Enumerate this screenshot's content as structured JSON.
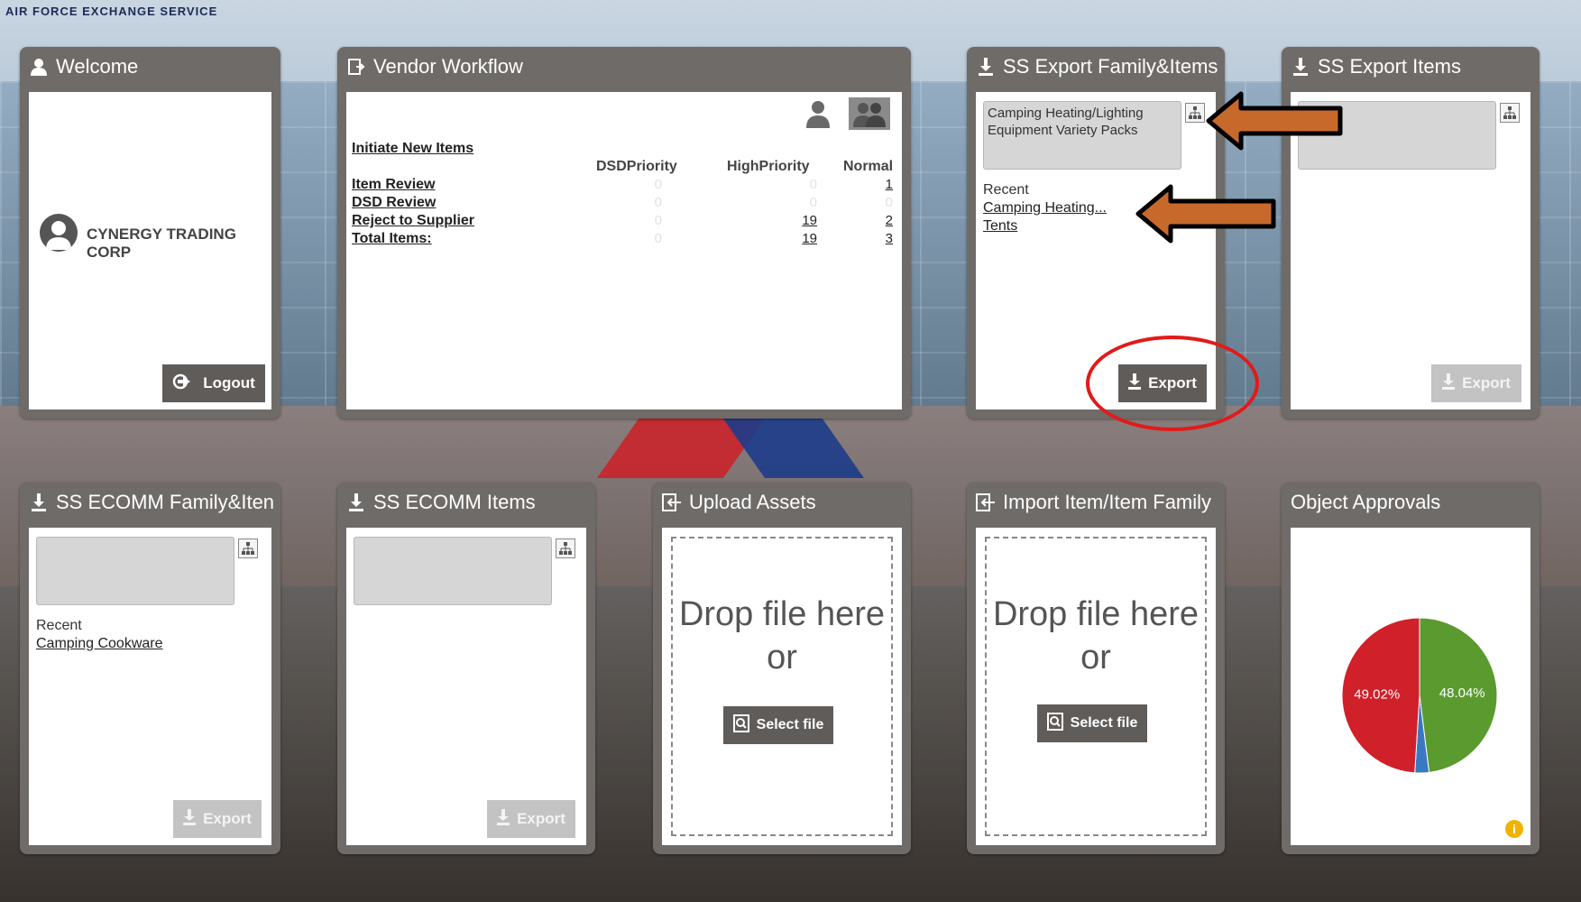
{
  "brand": "AIR FORCE EXCHANGE SERVICE",
  "welcome": {
    "title": "Welcome",
    "company": "CYNERGY TRADING CORP",
    "logout_label": "Logout"
  },
  "vendor_workflow": {
    "title": "Vendor Workflow",
    "initiate_label": "Initiate New Items",
    "columns": [
      "DSDPriority",
      "HighPriority",
      "Normal"
    ],
    "rows": [
      {
        "label": "Item Review",
        "dsd": "0",
        "high": "0",
        "normal": "1"
      },
      {
        "label": "DSD Review",
        "dsd": "0",
        "high": "0",
        "normal": "0"
      },
      {
        "label": "Reject to Supplier",
        "dsd": "0",
        "high": "19",
        "normal": "2"
      },
      {
        "label": "Total Items:",
        "dsd": "0",
        "high": "19",
        "normal": "3"
      }
    ]
  },
  "ss_export_family": {
    "title": "SS Export Family&Items",
    "selected": "Camping Heating/Lighting Equipment Variety Packs",
    "recent_label": "Recent",
    "recent": [
      "Camping Heating...",
      "Tents"
    ],
    "export_label": "Export"
  },
  "ss_export_items": {
    "title": "SS Export Items",
    "export_label": "Export"
  },
  "ss_ecomm_family": {
    "title": "SS ECOMM Family&Iten",
    "recent_label": "Recent",
    "recent": [
      "Camping Cookware"
    ],
    "export_label": "Export"
  },
  "ss_ecomm_items": {
    "title": "SS ECOMM Items",
    "export_label": "Export"
  },
  "upload_assets": {
    "title": "Upload Assets",
    "drop_line1": "Drop file here",
    "drop_line2": "or",
    "select_label": "Select file"
  },
  "import_item": {
    "title": "Import Item/Item Family",
    "drop_line1": "Drop file here",
    "drop_line2": "or",
    "select_label": "Select file"
  },
  "object_approvals": {
    "title": "Object Approvals"
  },
  "colors": {
    "panel": "#6f6b68",
    "pie_red": "#d0202a",
    "pie_green": "#5a9a2f",
    "pie_blue": "#3a78c2",
    "arrow": "#c8692c",
    "ring": "#e21a1a"
  },
  "chart_data": {
    "type": "pie",
    "slices": [
      {
        "label": "49.02%",
        "value": 49.02,
        "color": "#d0202a"
      },
      {
        "label": "48.04%",
        "value": 48.04,
        "color": "#5a9a2f"
      },
      {
        "label": "",
        "value": 2.94,
        "color": "#3a78c2"
      }
    ]
  }
}
